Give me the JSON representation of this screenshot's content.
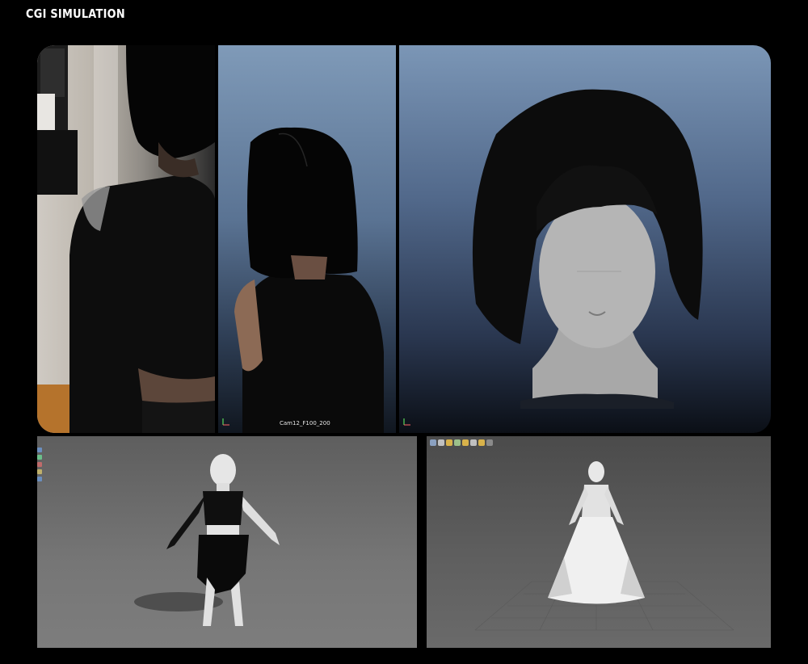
{
  "page": {
    "title": "CGI SIMULATION"
  },
  "render_panels": {
    "center_panel": {
      "camera_label": "Cam12_F100_200"
    }
  },
  "toolbar": {
    "icons": [
      "shelf-icon-1",
      "shelf-icon-2",
      "shelf-icon-3",
      "shelf-icon-4",
      "shelf-icon-5",
      "shelf-icon-6",
      "shelf-icon-7",
      "shelf-icon-8"
    ]
  },
  "colors": {
    "background": "#000000",
    "title_text": "#ffffff",
    "viewport_sky_blue": "#7b96b6",
    "viewport_grey": "#6a6a6a"
  }
}
